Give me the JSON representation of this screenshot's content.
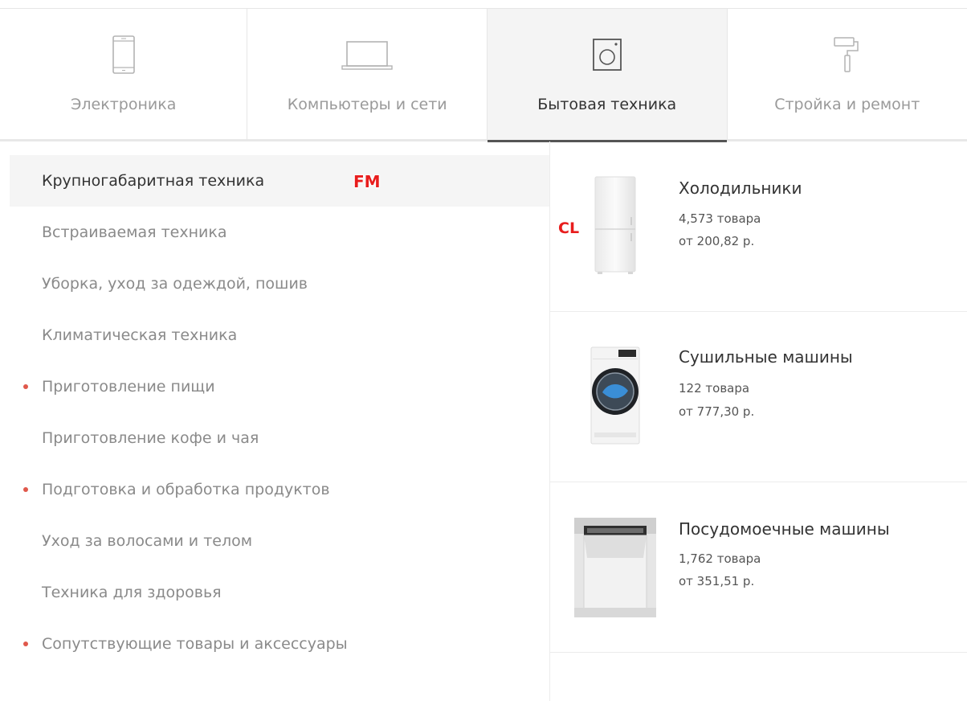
{
  "tabs": [
    {
      "label": "Электроника",
      "icon": "smartphone-icon",
      "active": false
    },
    {
      "label": "Компьютеры и сети",
      "icon": "laptop-icon",
      "active": false
    },
    {
      "label": "Бытовая техника",
      "icon": "washing-machine-icon",
      "active": true
    },
    {
      "label": "Стройка и ремонт",
      "icon": "paint-roller-icon",
      "active": false
    }
  ],
  "subcategories": [
    {
      "label": "Крупногабаритная техника",
      "active": true,
      "dot": false
    },
    {
      "label": "Встраиваемая техника",
      "active": false,
      "dot": false
    },
    {
      "label": "Уборка, уход за одеждой, пошив",
      "active": false,
      "dot": false
    },
    {
      "label": "Климатическая техника",
      "active": false,
      "dot": false
    },
    {
      "label": "Приготовление пищи",
      "active": false,
      "dot": true
    },
    {
      "label": "Приготовление кофе и чая",
      "active": false,
      "dot": false
    },
    {
      "label": "Подготовка и обработка продуктов",
      "active": false,
      "dot": true
    },
    {
      "label": "Уход за волосами и телом",
      "active": false,
      "dot": false
    },
    {
      "label": "Техника для здоровья",
      "active": false,
      "dot": false
    },
    {
      "label": "Сопутствующие товары и аксессуары",
      "active": false,
      "dot": true
    }
  ],
  "products": [
    {
      "title": "Холодильники",
      "count": "4,573 товара",
      "price": "от 200,82 р.",
      "image": "refrigerator-image"
    },
    {
      "title": "Сушильные машины",
      "count": "122 товара",
      "price": "от 777,30 р.",
      "image": "dryer-image"
    },
    {
      "title": "Посудомоечные машины",
      "count": "1,762 товара",
      "price": "от 351,51 р.",
      "image": "dishwasher-image"
    }
  ],
  "overlays": {
    "fm": "FM",
    "cl": "CL"
  },
  "colors": {
    "dot": "#e0584b",
    "overlay_label": "#e81d1d",
    "active_tab_underline": "#555555"
  }
}
